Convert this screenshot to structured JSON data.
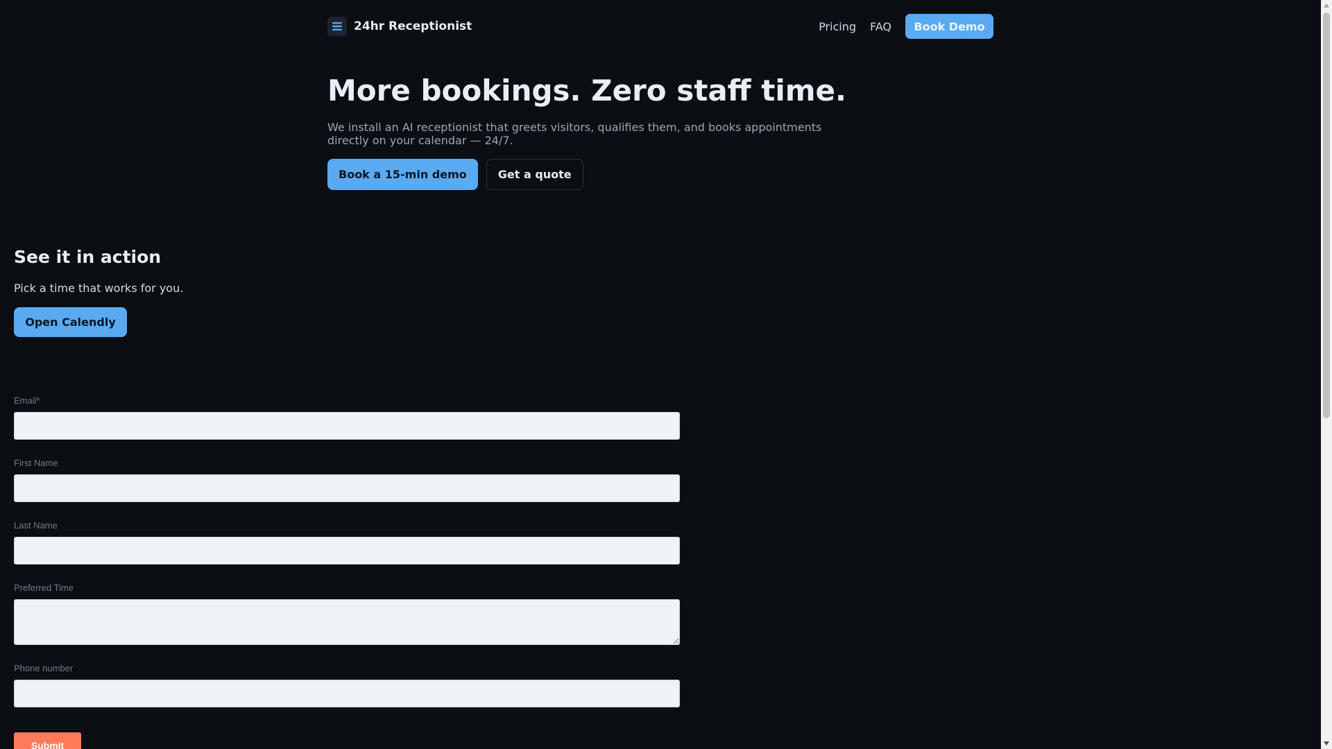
{
  "header": {
    "brand_name": "24hr Receptionist",
    "brand_icon": "menu-lines-icon",
    "nav": [
      {
        "label": "Pricing"
      },
      {
        "label": "FAQ"
      }
    ],
    "cta_label": "Book Demo"
  },
  "hero": {
    "title": "More bookings. Zero staff time.",
    "subtitle": "We install an AI receptionist that greets visitors, qualifies them, and books appointments directly on your calendar — 24/7.",
    "primary_cta": "Book a 15-min demo",
    "secondary_cta": "Get a quote"
  },
  "demo": {
    "title": "See it in action",
    "subtitle": "Pick a time that works for you.",
    "cta": "Open Calendly"
  },
  "form": {
    "fields": [
      {
        "label": "Email",
        "required_mark": "*",
        "value": ""
      },
      {
        "label": "First Name",
        "value": ""
      },
      {
        "label": "Last Name",
        "value": ""
      },
      {
        "label": "Preferred Time",
        "value": ""
      },
      {
        "label": "Phone number",
        "value": ""
      }
    ],
    "submit_label": "Submit"
  },
  "colors": {
    "background": "#0b0f14",
    "accent": "#5aaaf2",
    "submit": "#ff7a59",
    "required": "#e0533d"
  }
}
